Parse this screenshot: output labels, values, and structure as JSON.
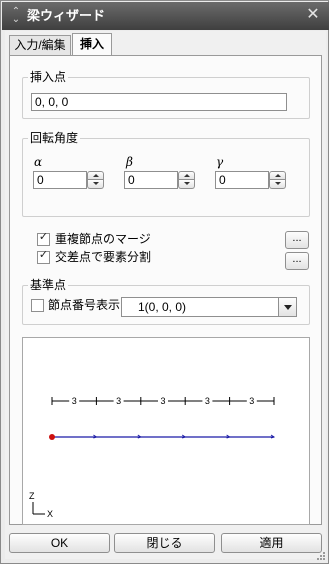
{
  "window": {
    "title": "梁ウィザード",
    "close_glyph": "✕"
  },
  "tabs": [
    {
      "label": "入力/編集",
      "active": false
    },
    {
      "label": "挿入",
      "active": true
    }
  ],
  "insert_point": {
    "label": "挿入点",
    "value": "0, 0, 0"
  },
  "rotation": {
    "label": "回転角度",
    "alpha": {
      "symbol": "α",
      "value": "0"
    },
    "beta": {
      "symbol": "β",
      "value": "0"
    },
    "gamma": {
      "symbol": "γ",
      "value": "0"
    }
  },
  "options": {
    "merge_nodes": {
      "label": "重複節点のマージ",
      "checked": true
    },
    "split_at_intersections": {
      "label": "交差点で要素分割",
      "checked": true
    },
    "ellipsis_label": "..."
  },
  "reference_point": {
    "label": "基準点",
    "show_node_numbers": {
      "label": "節点番号表示",
      "checked": false
    },
    "selected_value": "1(0, 0, 0)"
  },
  "preview": {
    "segment_label": "3",
    "segment_count": 5,
    "axis_z_label": "Z",
    "axis_x_label": "X",
    "beam_color": "#1a1aa6",
    "node_color": "#cc1010"
  },
  "buttons": {
    "ok": "OK",
    "close": "閉じる",
    "apply": "適用"
  }
}
